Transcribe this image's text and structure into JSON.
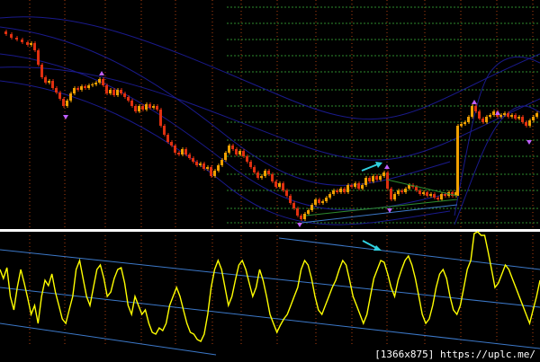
{
  "watermark": "[1366x875] https://uplc.me/",
  "colors": {
    "background": "#000000",
    "bull_candle": "#f0a000",
    "bear_candle": "#e03010",
    "oscillator": "#ffff00",
    "separator": "#ffffff",
    "trendline": "#3c78c8",
    "signal_arrow": "#30d0e0",
    "fractal_marker": "#c060ff",
    "vertical_grid": "#b04010",
    "horizontal_levels": "#2e8b2e",
    "envelope": "#1a1a8c"
  },
  "icons": {
    "divergence_arrow_main": "arrow-up-right-icon",
    "divergence_arrow_oscillator": "arrow-down-right-icon",
    "fractal": "fractal-arrow-icon"
  }
}
